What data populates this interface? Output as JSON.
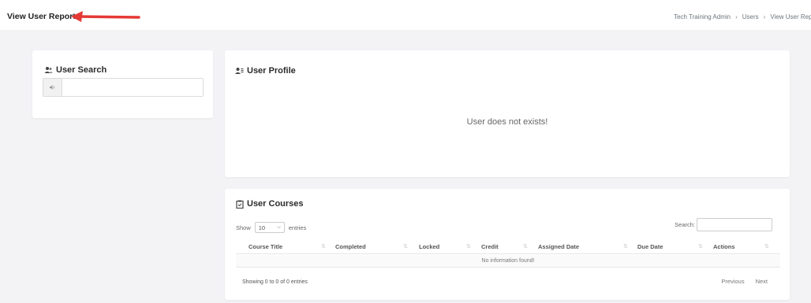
{
  "header": {
    "title": "View User Report",
    "breadcrumb": [
      "Tech Training Admin",
      "Users",
      "View User Repo"
    ]
  },
  "colors": {
    "arrow": "#e53935",
    "background": "#f3f3f6"
  },
  "user_search": {
    "title": "User Search",
    "icon": "users-icon",
    "addon_icon": "speaker-icon",
    "input_value": ""
  },
  "user_profile": {
    "title": "User Profile",
    "icon": "user-list-icon",
    "message": "User does not exists!"
  },
  "user_courses": {
    "title": "User Courses",
    "icon": "clipboard-icon",
    "show_label": "Show",
    "page_size": "10",
    "entries_label": "entries",
    "search_label": "Search:",
    "search_value": "",
    "columns": [
      "Course Title",
      "Completed",
      "Locked",
      "Credit",
      "Assigned Date",
      "Due Date",
      "Actions"
    ],
    "empty_text": "No information found!",
    "info": "Showing 0 to 0 of 0 entries",
    "prev_label": "Previous",
    "next_label": "Next"
  }
}
